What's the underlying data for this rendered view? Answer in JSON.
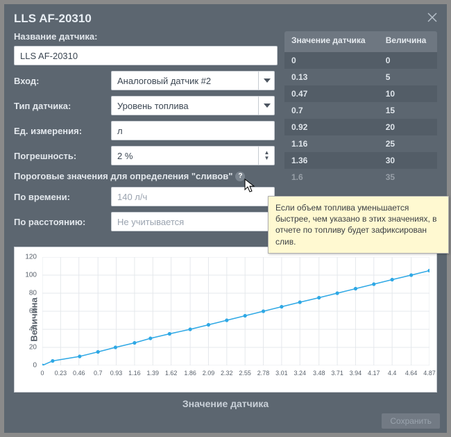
{
  "title": "LLS AF-20310",
  "form": {
    "name_label": "Название датчика:",
    "name_value": "LLS AF-20310",
    "input_label": "Вход:",
    "input_value": "Аналоговый датчик #2",
    "type_label": "Тип датчика:",
    "type_value": "Уровень топлива",
    "units_label": "Ед. измерения:",
    "units_value": "л",
    "error_label": "Погрешность:",
    "error_value": "2 %",
    "threshold_section": "Пороговые значения для определения \"сливов\"",
    "by_time_label": "По времени:",
    "by_time_placeholder": "140 л/ч",
    "by_distance_label": "По расстоянию:",
    "by_distance_placeholder": "Не учитывается"
  },
  "table": {
    "col1": "Значение датчика",
    "col2": "Величина",
    "rows": [
      {
        "x": "0",
        "y": "0"
      },
      {
        "x": "0.13",
        "y": "5"
      },
      {
        "x": "0.47",
        "y": "10"
      },
      {
        "x": "0.7",
        "y": "15"
      },
      {
        "x": "0.92",
        "y": "20"
      },
      {
        "x": "1.16",
        "y": "25"
      },
      {
        "x": "1.36",
        "y": "30"
      },
      {
        "x": "1.6",
        "y": "35"
      }
    ]
  },
  "tooltip": "Если объем топлива уменьшается быстрее, чем указано в этих значениях, в отчете по топливу будет зафиксирован слив.",
  "footer": {
    "save": "Сохранить"
  },
  "chart": {
    "y_title": "Величина",
    "x_title": "Значение датчика"
  },
  "chart_data": {
    "type": "line",
    "xlabel": "Значение датчика",
    "ylabel": "Величина",
    "xlim": [
      0,
      4.87
    ],
    "ylim": [
      0,
      120
    ],
    "y_ticks": [
      0,
      20,
      40,
      60,
      80,
      100,
      120
    ],
    "x_ticks": [
      0,
      0.23,
      0.46,
      0.7,
      0.93,
      1.16,
      1.39,
      1.62,
      1.86,
      2.09,
      2.32,
      2.55,
      2.78,
      3.01,
      3.24,
      3.48,
      3.71,
      3.94,
      4.17,
      4.4,
      4.64,
      4.87
    ],
    "x": [
      0,
      0.13,
      0.47,
      0.7,
      0.92,
      1.16,
      1.36,
      1.6,
      1.86,
      2.09,
      2.32,
      2.55,
      2.78,
      3.01,
      3.24,
      3.48,
      3.71,
      3.94,
      4.17,
      4.4,
      4.64,
      4.87
    ],
    "y": [
      0,
      5,
      10,
      15,
      20,
      25,
      30,
      35,
      40,
      45,
      50,
      55,
      60,
      65,
      70,
      75,
      80,
      85,
      90,
      95,
      100,
      105
    ]
  }
}
